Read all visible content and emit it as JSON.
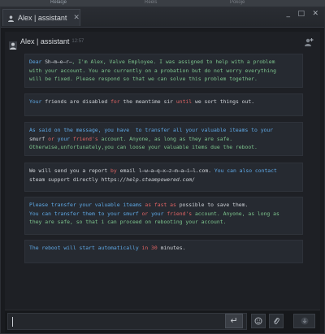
{
  "background_tabs": [
    "Relacje",
    "Reels",
    "Pokoje"
  ],
  "window": {
    "tab_title": "Alex | assistant",
    "tab_close": "✕",
    "controls": {
      "minimize": "_",
      "maximize": "□",
      "close": "✕"
    }
  },
  "chat": {
    "sender": "Alex | assistant",
    "timestamp": "12:57",
    "messages": [
      {
        "lines": [
          [
            {
              "t": "Dear ",
              "c": "b"
            },
            {
              "t": "Sh̶m̶e̶r̶",
              "c": "x"
            },
            {
              "t": ", I'm Alex, Valve Employee. I was assigned to help with a problem",
              "c": "g"
            }
          ],
          [
            {
              "t": "with your account. You are currently on a probation but do not worry everything",
              "c": "g"
            }
          ],
          [
            {
              "t": "will be fixed. Please respond so that we can solve this problem together.",
              "c": "g"
            }
          ]
        ]
      },
      {
        "lines": [
          [
            {
              "t": "Your ",
              "c": "b"
            },
            {
              "t": "friends are disabled ",
              "c": "k"
            },
            {
              "t": "for ",
              "c": "r"
            },
            {
              "t": "the meantime sir ",
              "c": "k"
            },
            {
              "t": "until ",
              "c": "r"
            },
            {
              "t": "we sort things out.",
              "c": "k"
            }
          ]
        ]
      },
      {
        "lines": [
          [
            {
              "t": "As said on the message, you have  to transfer all your valuable iteams to your",
              "c": "b"
            }
          ],
          [
            {
              "t": "smurf ",
              "c": "k"
            },
            {
              "t": "or ",
              "c": "r"
            },
            {
              "t": "your ",
              "c": "b"
            },
            {
              "t": "friend's",
              "c": "r"
            },
            {
              "t": " account. Anyone, as long as they are safe.",
              "c": "g"
            }
          ],
          [
            {
              "t": "Otherwise,unfortunately,you can loose your valuable items due the reboot.",
              "c": "g"
            }
          ]
        ]
      },
      {
        "lines": [
          [
            {
              "t": "We will send you a report ",
              "c": "k"
            },
            {
              "t": "by ",
              "c": "r"
            },
            {
              "t": "email ",
              "c": "k"
            },
            {
              "t": "l̶w̶a̶q̶x̶z̶m̶a̶i̶l",
              "c": "x"
            },
            {
              "t": ".com. ",
              "c": "k"
            },
            {
              "t": "You can also contact",
              "c": "b"
            }
          ],
          [
            {
              "t": "steam support directly https:",
              "c": "k"
            },
            {
              "t": "//help.steampowered.com/",
              "c": "i"
            }
          ]
        ]
      },
      {
        "lines": [
          [
            {
              "t": "Please transfer your valuable iteams ",
              "c": "b"
            },
            {
              "t": "as fast as ",
              "c": "r"
            },
            {
              "t": "possible to save them.",
              "c": "k"
            }
          ],
          [
            {
              "t": "You can transfer them to your smurf ",
              "c": "b"
            },
            {
              "t": "or ",
              "c": "r"
            },
            {
              "t": "your ",
              "c": "b"
            },
            {
              "t": "friend's",
              "c": "r"
            },
            {
              "t": " account. Anyone, as long as",
              "c": "g"
            }
          ],
          [
            {
              "t": "they are safe, so that i can proceed on rebooting your account.",
              "c": "g"
            }
          ]
        ]
      },
      {
        "lines": [
          [
            {
              "t": "The reboot will start automatically ",
              "c": "b"
            },
            {
              "t": "in 30 ",
              "c": "r"
            },
            {
              "t": "minutes.",
              "c": "k"
            }
          ]
        ]
      }
    ]
  },
  "input": {
    "value": "",
    "send_glyph": "↵",
    "icons": [
      "emoticon-icon",
      "attach-icon",
      "more-icon"
    ]
  },
  "colors": {
    "blue": "#5fa9e6",
    "green": "#7dc48d",
    "red": "#e06464",
    "light": "#cfd3d8",
    "accent": "#6b9ed1"
  }
}
